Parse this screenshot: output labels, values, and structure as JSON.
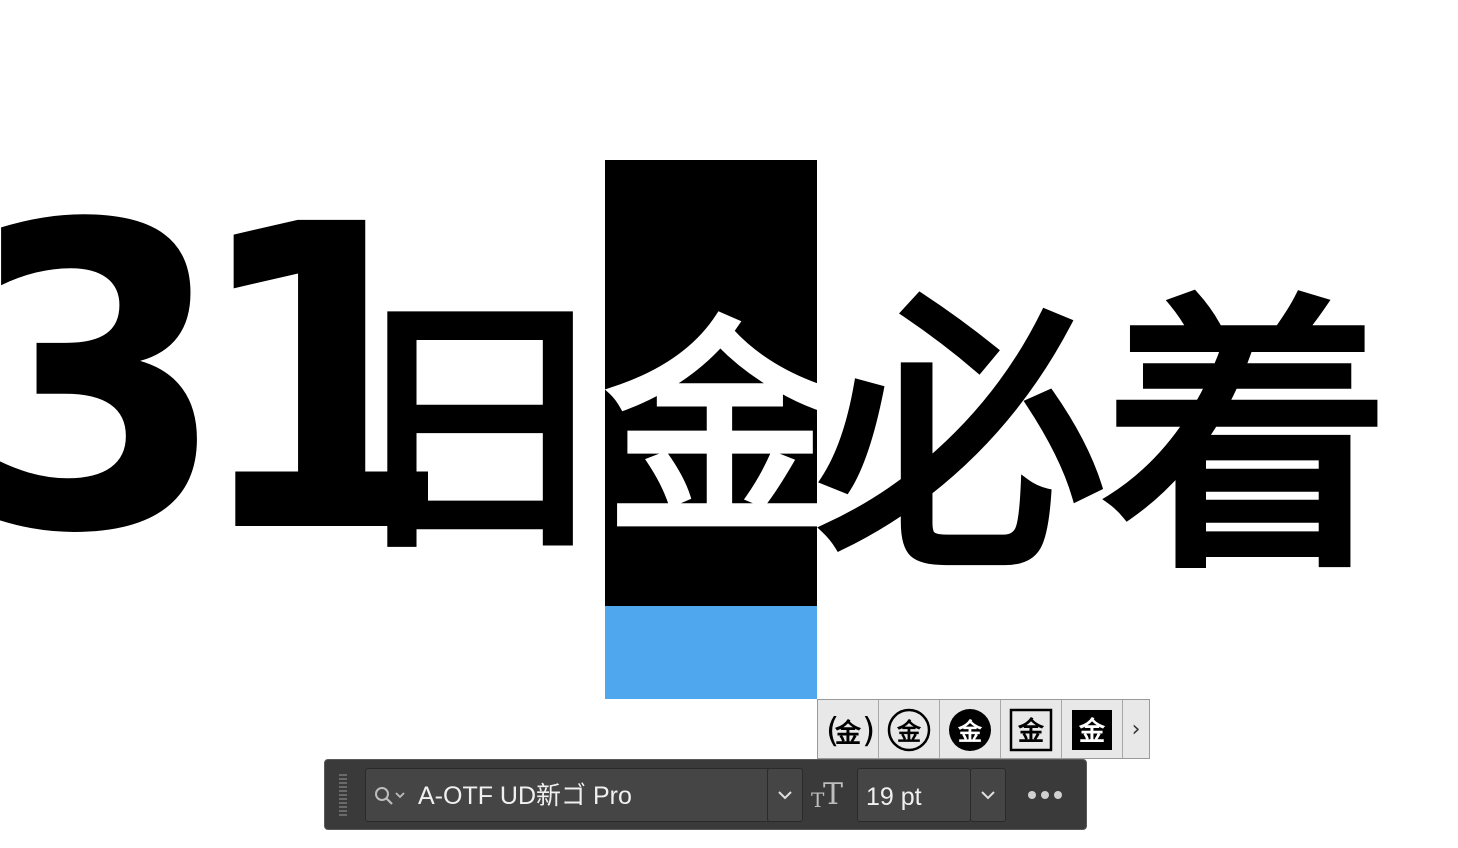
{
  "canvas": {
    "headline": {
      "digits": "31",
      "day": "日",
      "selected_char": "金",
      "must": "必",
      "arrive": "着"
    },
    "selection_color": "#4fa8ee"
  },
  "alternates": {
    "glyphs": [
      "金",
      "金",
      "金",
      "金",
      "金"
    ],
    "styles": [
      "parenthesized",
      "circled",
      "black-circled",
      "squared",
      "black-squared"
    ],
    "next_icon": "chevron-right-icon"
  },
  "taskbar": {
    "font_name": "A-OTF UD新ゴ Pro",
    "font_size": "19 pt",
    "icons": {
      "grip": "drag-handle-icon",
      "search": "search-icon",
      "font_dropdown": "chevron-down-icon",
      "size": "font-size-icon",
      "size_dropdown": "chevron-down-icon",
      "more": "more-options-icon"
    }
  }
}
